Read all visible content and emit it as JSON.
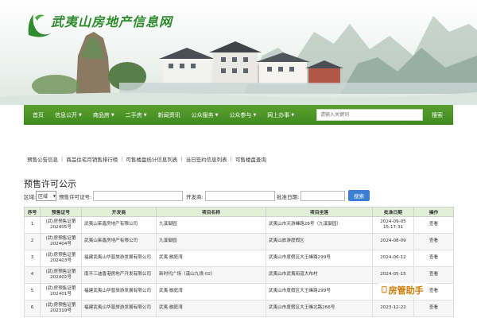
{
  "site": {
    "logo_text": "武夷山房地产信息网"
  },
  "nav": {
    "items": [
      {
        "label": "首页",
        "caret": ""
      },
      {
        "label": "信息公开",
        "caret": "▼"
      },
      {
        "label": "商品房",
        "caret": "▼"
      },
      {
        "label": "二手房",
        "caret": "▼"
      },
      {
        "label": "新闻资讯",
        "caret": ""
      },
      {
        "label": "公众服务",
        "caret": "▼"
      },
      {
        "label": "公众参与",
        "caret": "▼"
      },
      {
        "label": "网上办事",
        "caret": "▼"
      }
    ],
    "search_placeholder": "请输入关键词",
    "search_label": "搜索"
  },
  "subnav": {
    "links": [
      "预售公告信息",
      "商品住宅月销售排行榜",
      "可售楼盘统计信息列表",
      "当日签约信息列表",
      "可售楼盘查询"
    ]
  },
  "page_title": "预售许可公示",
  "filters": {
    "district_label": "区域:",
    "district_value": "区域",
    "permit_label": "预售许可证号:",
    "developer_label": "开发商:",
    "approval_label": "批准日期:",
    "search_label": "搜索"
  },
  "table": {
    "headers": [
      "序号",
      "预售证号",
      "开发商",
      "项目名称",
      "项目坐落",
      "批准日期",
      "操作"
    ],
    "rows": [
      [
        "1",
        "(武)房预售证第202405号",
        "武夷山茱鑫房地产有限公司",
        "九溪御园",
        "武夷山市天游峰路28号（九溪御园）",
        "2024-09-05 15:17:31",
        "查看"
      ],
      [
        "2",
        "(武)房预售证第202404号",
        "武夷山茱鑫房地产有限公司",
        "九溪御园",
        "武夷山旅游度假区",
        "2024-08-09",
        "查看"
      ],
      [
        "3",
        "(武)房预售证第202403号",
        "福建武夷山华晋旅游发展有限公司",
        "武夷·融庭湾",
        "武夷山市度假区大王峰路299号",
        "2024-06-12",
        "查看"
      ],
      [
        "4",
        "(武)房预售证第202402号",
        "南平三迪香港房地产开发有限公司",
        "新时代广场（溪山九境-02）",
        "武夷山市武夷街道大布村",
        "2024-05-15",
        "查看"
      ],
      [
        "5",
        "(武)房预售证第202401号",
        "福建武夷山华晋旅游发展有限公司",
        "武夷·融庭湾",
        "武夷山市度假区大王峰路299号",
        "2024-03-08",
        "查看"
      ],
      [
        "6",
        "(武)房预售证第202319号",
        "福建武夷山华晋旅游发展有限公司",
        "武夷·融庭湾",
        "武夷山市度假区大王峰北路266号",
        "2023-12-22",
        "查看"
      ]
    ]
  },
  "watermark": {
    "text": "房管助手"
  },
  "colors": {
    "nav_green": "#4a9426",
    "header_green": "#e2efd9",
    "search_blue": "#3a7fd5",
    "logo_green": "#2e8b2e"
  }
}
